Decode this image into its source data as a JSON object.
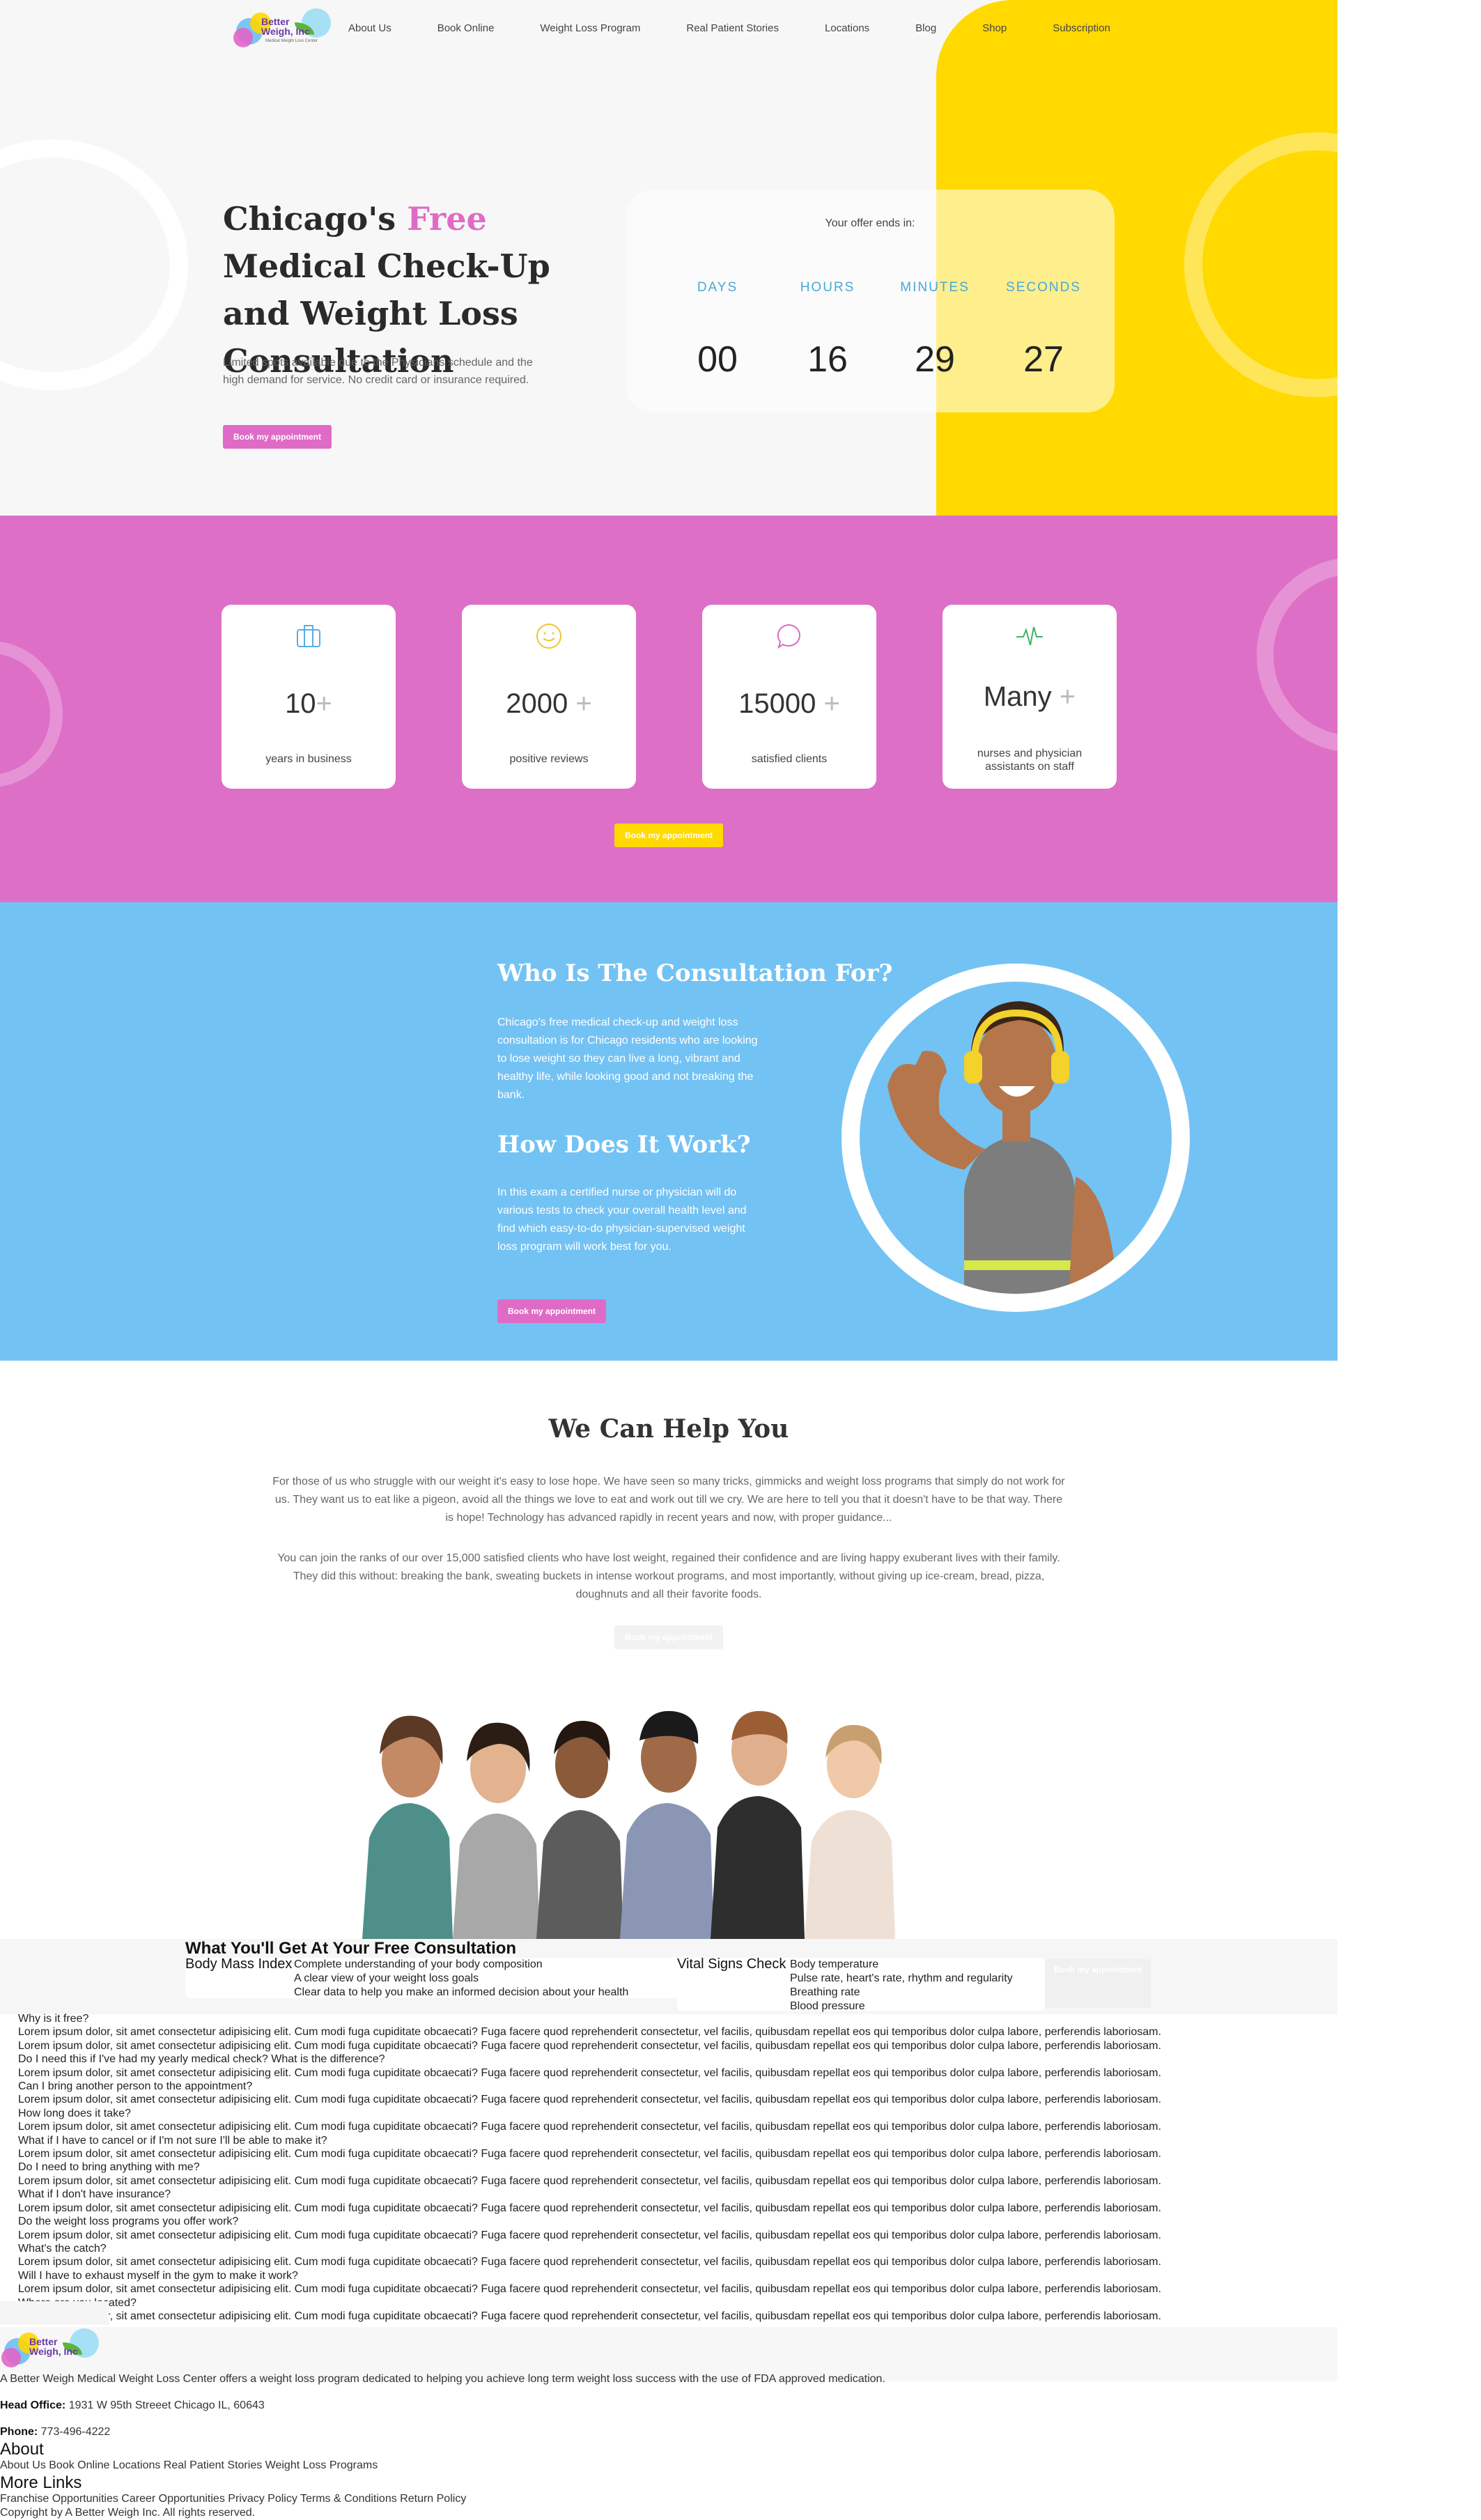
{
  "logo": {
    "text_line1": "Better",
    "text_line2": "Weigh, Inc",
    "tagline": "Medical Weight Loss Center"
  },
  "nav": [
    "About Us",
    "Book Online",
    "Weight Loss Program",
    "Real Patient Stories",
    "Locations",
    "Blog",
    "Shop",
    "Subscription"
  ],
  "hero": {
    "title_pre": "Chicago's ",
    "title_highlight": "Free",
    "title_post": " Medical Check-Up and Weight Loss Consultation",
    "subtitle": "Limited spots available due to the Physicians schedule and the high demand for service. No credit card or insurance required.",
    "button": "Book my appointment",
    "offer_label": "Your offer ends in:",
    "countdown": [
      {
        "label": "DAYS",
        "value": "00"
      },
      {
        "label": "HOURS",
        "value": "16"
      },
      {
        "label": "MINUTES",
        "value": "29"
      },
      {
        "label": "SECONDS",
        "value": "27"
      }
    ]
  },
  "stats": {
    "cards": [
      {
        "icon": "briefcase-icon",
        "glyph": "▣",
        "color": "#5aaee0",
        "number": "10",
        "plus": "+",
        "label": "years in business"
      },
      {
        "icon": "smile-icon",
        "glyph": "☺",
        "color": "#f1c232",
        "number": "2000",
        "plus": " +",
        "label": "positive reviews"
      },
      {
        "icon": "chat-bubble-icon",
        "glyph": "○",
        "color": "#d86bc6",
        "number": "15000",
        "plus": " +",
        "label": "satisfied clients"
      },
      {
        "icon": "pulse-icon",
        "glyph": "∿",
        "color": "#3fb36a",
        "number": "Many",
        "plus": " +",
        "label": "nurses and physician assistants on staff"
      }
    ],
    "button": "Book my appointment"
  },
  "consult": {
    "heading1": "Who Is The Consultation For?",
    "para1": "Chicago's free medical check-up and weight loss consultation is for Chicago residents who are looking to lose weight so they can live a long, vibrant and healthy life, while looking good and not breaking the bank.",
    "heading2": "How Does It Work?",
    "para2": "In this exam a certified nurse or physician will do various tests to check your overall health level and find which easy-to-do physician-supervised weight loss program will work best for you.",
    "button": "Book my appointment"
  },
  "help": {
    "heading": "We Can Help You",
    "para1": "For those of us who struggle with our weight it's easy to lose hope. We have seen so many tricks, gimmicks and weight loss programs that simply do not work for us. They want us to eat like a pigeon, avoid all the things we love to eat and work out till we cry. We are here to tell you that it doesn't have to be that way. There is hope! Technology has advanced rapidly in recent years and now, with proper guidance...",
    "para2": "You can join the ranks of our over 15,000 satisfied clients who have lost weight, regained their confidence and are living happy exuberant lives with their family. They did this without: breaking the bank, sweating buckets in intense workout programs, and most importantly, without giving up ice-cream, bread, pizza, doughnuts and all their favorite foods.",
    "button": "Book my appointment"
  },
  "get": {
    "title": "What You'll Get At Your Free Consultation",
    "bmi_title": "Body Mass Index",
    "bmi_items": [
      "Complete understanding of your body composition",
      "A clear view of your weight loss goals",
      "Clear data to help you make an informed decision about your health"
    ],
    "vital_title": "Vital Signs Check",
    "vital_items": [
      "Body temperature",
      "Pulse rate, heart's rate, rhythm and regularity",
      "Breathing rate",
      "Blood pressure"
    ],
    "button": "Book my appointment"
  },
  "faq": {
    "lorem": "Lorem ipsum dolor, sit amet consectetur adipisicing elit. Cum modi fuga cupiditate obcaecati? Fuga facere quod reprehenderit consectetur, vel facilis, quibusdam repellat eos qui temporibus dolor culpa labore, perferendis laboriosam.",
    "q1": "Why is it free?",
    "q2": "Do I need this if I've had my yearly medical check? What is the difference?",
    "q3": "Can I bring another person to the appointment?",
    "q4": "How long does it take?",
    "q5": "What if I have to cancel or if I'm not sure I'll be able to make it?",
    "q6": "Do I need to bring anything with me?",
    "q7": "What if I don't have insurance?",
    "q8": "Do the weight loss programs you offer work?",
    "q9": "What's the catch?",
    "q10": "Will I have to exhaust myself in the gym to make it work?",
    "q11": "Where are you located?"
  },
  "footer": {
    "description": "A Better Weigh Medical Weight Loss Center offers a weight loss program dedicated to helping you achieve long term weight loss success with the use of FDA approved medication.",
    "office_label": "Head Office:",
    "office_value": " 1931 W 95th Streeet Chicago IL, 60643",
    "phone_label": "Phone:",
    "phone_value": " 773-496-4222",
    "about_heading": "About",
    "about_links": "About Us Book Online Locations Real Patient Stories Weight Loss Programs",
    "more_heading": "More Links",
    "more_links": "Franchise Opportunities Career Opportunities Privacy Policy Terms & Conditions Return Policy",
    "copyright": "Copyright by A Better Weigh Inc. All rights reserved."
  },
  "colors": {
    "yellow": "#ffd900",
    "pink": "#de6fc7",
    "blue": "#73c2f4",
    "accent_text": "#48a8d8"
  }
}
